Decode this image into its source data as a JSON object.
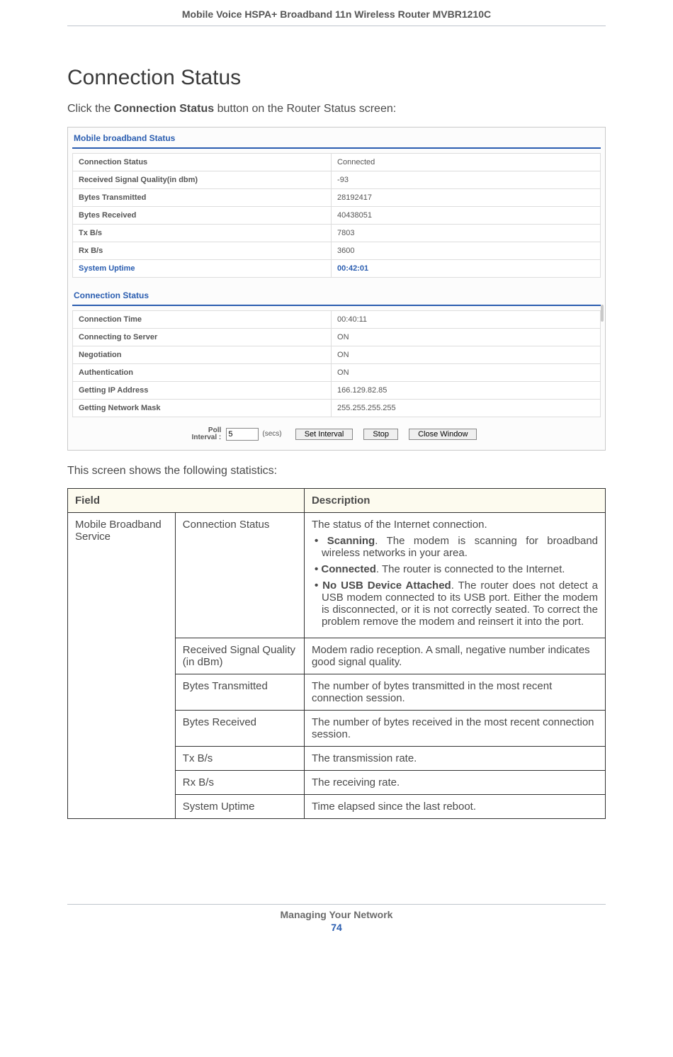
{
  "header": {
    "doc_title": "Mobile Voice HSPA+ Broadband 11n Wireless Router MVBR1210C"
  },
  "section": {
    "title": "Connection Status"
  },
  "intro": {
    "pre": "Click the ",
    "bold": "Connection Status",
    "post": " button on the Router Status screen:"
  },
  "screenshot": {
    "heading1": "Mobile broadband Status",
    "table1": [
      {
        "label": "Connection Status",
        "value": "Connected"
      },
      {
        "label": "Received Signal Quality(in dbm)",
        "value": "-93"
      },
      {
        "label": "Bytes Transmitted",
        "value": "28192417"
      },
      {
        "label": "Bytes Received",
        "value": "40438051"
      },
      {
        "label": "Tx B/s",
        "value": "7803"
      },
      {
        "label": "Rx B/s",
        "value": "3600"
      },
      {
        "label": "System Uptime",
        "value": "00:42:01",
        "accent": true
      }
    ],
    "heading2": "Connection Status",
    "table2": [
      {
        "label": "Connection Time",
        "value": "00:40:11"
      },
      {
        "label": "Connecting to Server",
        "value": "ON"
      },
      {
        "label": "Negotiation",
        "value": "ON"
      },
      {
        "label": "Authentication",
        "value": "ON"
      },
      {
        "label": "Getting IP Address",
        "value": "166.129.82.85"
      },
      {
        "label": "Getting Network Mask",
        "value": "255.255.255.255"
      }
    ],
    "controls": {
      "poll_label_l1": "Poll",
      "poll_label_l2": "Interval :",
      "poll_value": "5",
      "secs": "(secs)",
      "btn_set": "Set Interval",
      "btn_stop": "Stop",
      "btn_close": "Close Window"
    }
  },
  "caption": "This screen shows the following statistics:",
  "desc_table": {
    "head_field": "Field",
    "head_desc": "Description",
    "group_label": "Mobile Broadband Service",
    "rows": [
      {
        "field": "Connection Status",
        "desc_intro": "The status of the Internet connection.",
        "bullets": [
          {
            "bold": "Scanning",
            "text": ". The modem is scanning for broadband wireless networks in your area."
          },
          {
            "bold": "Connected",
            "text": ". The router is connected to the Internet."
          },
          {
            "bold": "No USB Device Attached",
            "text": ". The router does not detect a USB modem connected to its USB port. Either the modem is disconnected, or it is not correctly seated. To correct the problem remove the modem and reinsert it into the port."
          }
        ]
      },
      {
        "field": "Received Signal Quality (in dBm)",
        "desc": "Modem radio reception. A small, negative number indicates good signal quality."
      },
      {
        "field": "Bytes Transmitted",
        "desc": "The number of bytes transmitted in the most recent connection session."
      },
      {
        "field": "Bytes Received",
        "desc": "The number of bytes received in the most recent connection session."
      },
      {
        "field": "Tx B/s",
        "desc": "The transmission rate."
      },
      {
        "field": "Rx B/s",
        "desc": "The receiving rate."
      },
      {
        "field": "System Uptime",
        "desc": "Time elapsed since the last reboot."
      }
    ]
  },
  "footer": {
    "chapter": "Managing Your Network",
    "page": "74"
  }
}
